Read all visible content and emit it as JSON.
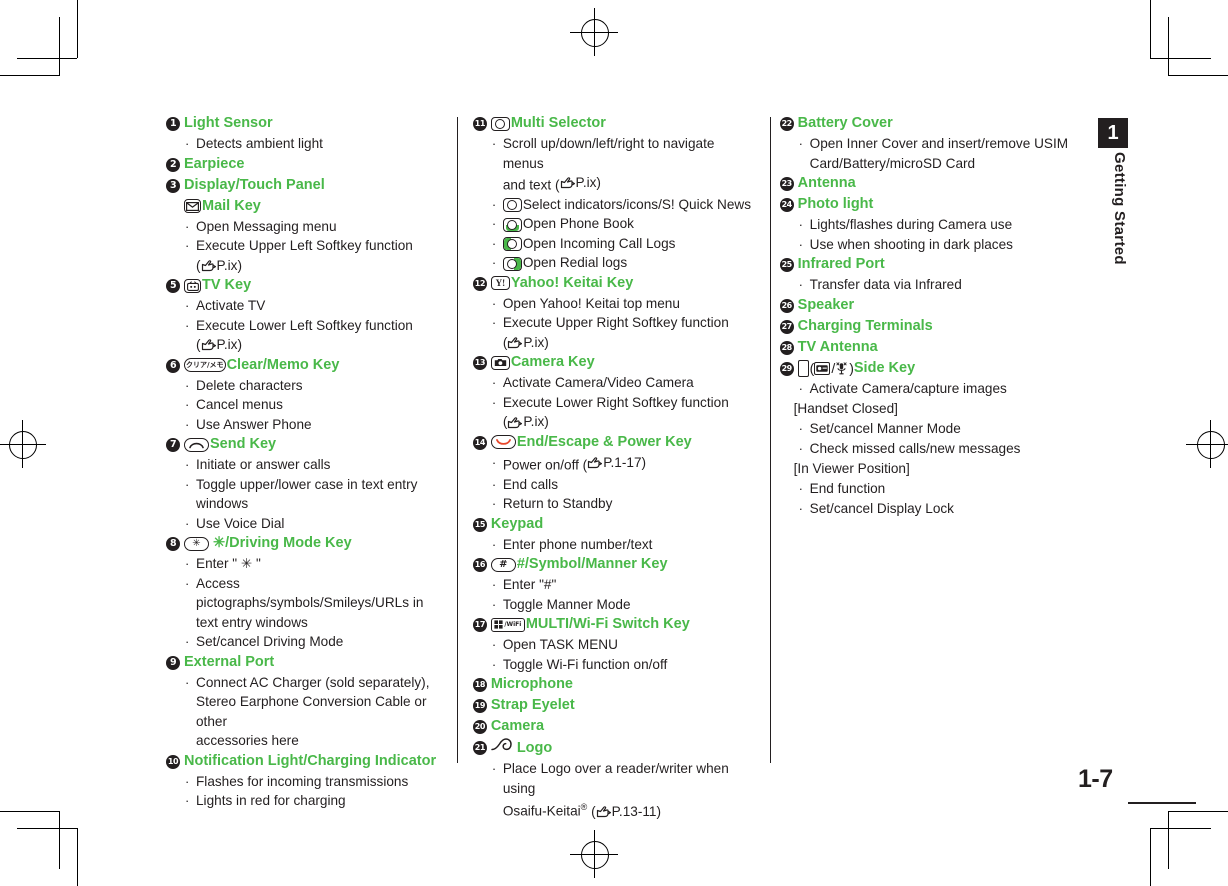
{
  "page": {
    "number": "1-7",
    "chapter_number": "1",
    "chapter_label": "Getting Started"
  },
  "columns": [
    {
      "id": "column-left",
      "items": [
        {
          "num": "❶",
          "num_text": "1",
          "title": "Light Sensor",
          "icon": null,
          "lines": [
            {
              "type": "bullet",
              "text": "Detects ambient light"
            }
          ]
        },
        {
          "num": "❷",
          "num_text": "2",
          "title": "Earpiece",
          "icon": null,
          "lines": []
        },
        {
          "num": "❸",
          "num_text": "3",
          "title": "Display/Touch Panel",
          "icon": null,
          "lines": []
        },
        {
          "num": "",
          "num_text": "",
          "title": "Mail Key",
          "icon": "mail-key-icon",
          "lines": [
            {
              "type": "bullet",
              "text": "Open Messaging menu"
            },
            {
              "type": "bullet",
              "text": "Execute Upper Left Softkey function"
            },
            {
              "type": "cont-ref",
              "text": "P.ix"
            }
          ]
        },
        {
          "num": "❺",
          "num_text": "5",
          "title": "TV Key",
          "icon": "tv-key-icon",
          "lines": [
            {
              "type": "bullet",
              "text": "Activate TV"
            },
            {
              "type": "bullet",
              "text": "Execute Lower Left Softkey function"
            },
            {
              "type": "cont-ref",
              "text": "P.ix"
            }
          ]
        },
        {
          "num": "❻",
          "num_text": "6",
          "title": "Clear/Memo Key",
          "icon": "clear-memo-key-icon",
          "icon_text": "クリア/メモ",
          "lines": [
            {
              "type": "bullet",
              "text": "Delete characters"
            },
            {
              "type": "bullet",
              "text": "Cancel menus"
            },
            {
              "type": "bullet",
              "text": "Use Answer Phone"
            }
          ]
        },
        {
          "num": "❼",
          "num_text": "7",
          "title": "Send Key",
          "icon": "send-key-icon",
          "lines": [
            {
              "type": "bullet",
              "text": "Initiate or answer calls"
            },
            {
              "type": "bullet",
              "text": "Toggle upper/lower case in text entry"
            },
            {
              "type": "cont",
              "text": "windows"
            },
            {
              "type": "bullet",
              "text": "Use Voice Dial"
            }
          ]
        },
        {
          "num": "❽",
          "num_text": "8",
          "title": "/Driving Mode Key",
          "title_prefix_glyph": "asterisk-glyph",
          "icon": "asterisk-key-icon",
          "lines": [
            {
              "type": "bullet",
              "text": "Enter \" ✳ \""
            },
            {
              "type": "bullet",
              "text": "Access pictographs/symbols/Smileys/URLs in"
            },
            {
              "type": "cont",
              "text": "text entry windows"
            },
            {
              "type": "bullet",
              "text": "Set/cancel Driving Mode"
            }
          ]
        },
        {
          "num": "❾",
          "num_text": "9",
          "title": "External Port",
          "icon": null,
          "lines": [
            {
              "type": "bullet",
              "text": "Connect AC Charger (sold separately),"
            },
            {
              "type": "cont",
              "text": "Stereo Earphone Conversion Cable or other"
            },
            {
              "type": "cont",
              "text": "accessories here"
            }
          ]
        },
        {
          "num": "❿",
          "num_text": "10",
          "title": "Notification Light/Charging Indicator",
          "icon": null,
          "lines": [
            {
              "type": "bullet",
              "text": "Flashes for incoming transmissions"
            },
            {
              "type": "bullet",
              "text": "Lights in red for charging"
            }
          ]
        }
      ]
    },
    {
      "id": "column-middle",
      "items": [
        {
          "num": "➀",
          "num_text": "11",
          "title": "Multi Selector",
          "icon": "multi-selector-icon",
          "lines": [
            {
              "type": "bullet",
              "text": "Scroll up/down/left/right to navigate menus"
            },
            {
              "type": "cont-ref2",
              "text": "and text (",
              "ref": "P.ix"
            },
            {
              "type": "bullet-icon",
              "icon": "multi-selector-center-icon",
              "text": "Select indicators/icons/S! Quick News"
            },
            {
              "type": "bullet-icon",
              "icon": "multi-selector-down-icon",
              "text": "Open Phone Book"
            },
            {
              "type": "bullet-icon",
              "icon": "multi-selector-left-icon",
              "text": "Open Incoming Call Logs"
            },
            {
              "type": "bullet-icon",
              "icon": "multi-selector-right-icon",
              "text": "Open Redial logs"
            }
          ]
        },
        {
          "num": "➁",
          "num_text": "12",
          "title": "Yahoo! Keitai Key",
          "icon": "yahoo-keitai-key-icon",
          "icon_text": "Y!",
          "lines": [
            {
              "type": "bullet",
              "text": "Open Yahoo! Keitai top menu"
            },
            {
              "type": "bullet",
              "text": "Execute Upper Right Softkey function"
            },
            {
              "type": "cont-ref",
              "text": "P.ix"
            }
          ]
        },
        {
          "num": "➂",
          "num_text": "13",
          "title": "Camera Key",
          "icon": "camera-key-icon",
          "lines": [
            {
              "type": "bullet",
              "text": "Activate Camera/Video Camera"
            },
            {
              "type": "bullet",
              "text": "Execute Lower Right Softkey function"
            },
            {
              "type": "cont-ref",
              "text": "P.ix"
            }
          ]
        },
        {
          "num": "➃",
          "num_text": "14",
          "title": "End/Escape & Power Key",
          "icon": "end-power-key-icon",
          "lines": [
            {
              "type": "bullet-ref",
              "text": "Power on/off (",
              "ref": "P.1-17"
            },
            {
              "type": "bullet",
              "text": "End calls"
            },
            {
              "type": "bullet",
              "text": "Return to Standby"
            }
          ]
        },
        {
          "num": "➄",
          "num_text": "15",
          "title": "Keypad",
          "icon": null,
          "lines": [
            {
              "type": "bullet",
              "text": "Enter phone number/text"
            }
          ]
        },
        {
          "num": "➅",
          "num_text": "16",
          "title": "#/Symbol/Manner Key",
          "icon": "hash-key-icon",
          "icon_text": "#",
          "lines": [
            {
              "type": "bullet",
              "text": "Enter \"#\""
            },
            {
              "type": "bullet",
              "text": "Toggle Manner Mode"
            }
          ]
        },
        {
          "num": "➆",
          "num_text": "17",
          "title": "MULTI/Wi-Fi Switch Key",
          "icon": "multi-wifi-key-icon",
          "icon_text": "/WiFi",
          "lines": [
            {
              "type": "bullet",
              "text": "Open TASK MENU"
            },
            {
              "type": "bullet",
              "text": "Toggle Wi-Fi function on/off"
            }
          ]
        },
        {
          "num": "➇",
          "num_text": "18",
          "title": "Microphone",
          "icon": null,
          "lines": []
        },
        {
          "num": "➈",
          "num_text": "19",
          "title": "Strap Eyelet",
          "icon": null,
          "lines": []
        },
        {
          "num": "➉",
          "num_text": "20",
          "title": "Camera",
          "icon": null,
          "lines": []
        },
        {
          "num": "➊",
          "num_text": "21",
          "title": "Logo",
          "icon": "osaifu-keitai-logo-icon",
          "lines": [
            {
              "type": "bullet",
              "text": "Place Logo over a reader/writer when using"
            },
            {
              "type": "cont-osaifu",
              "text": "Osaifu-Keitai",
              "sup": "®",
              "ref": "P.13-11"
            }
          ]
        }
      ]
    },
    {
      "id": "column-right",
      "items": [
        {
          "num": "➋",
          "num_text": "22",
          "title": "Battery Cover",
          "icon": null,
          "lines": [
            {
              "type": "bullet",
              "text": "Open Inner Cover and insert/remove USIM"
            },
            {
              "type": "cont",
              "text": "Card/Battery/microSD Card"
            }
          ]
        },
        {
          "num": "➌",
          "num_text": "23",
          "title": "Antenna",
          "icon": null,
          "lines": []
        },
        {
          "num": "➍",
          "num_text": "24",
          "title": "Photo light",
          "icon": null,
          "lines": [
            {
              "type": "bullet",
              "text": "Lights/flashes during Camera use"
            },
            {
              "type": "bullet",
              "text": "Use when shooting in dark places"
            }
          ]
        },
        {
          "num": "➎",
          "num_text": "25",
          "title": "Infrared Port",
          "icon": null,
          "lines": [
            {
              "type": "bullet",
              "text": "Transfer data via Infrared"
            }
          ]
        },
        {
          "num": "➏",
          "num_text": "26",
          "title": "Speaker",
          "icon": null,
          "lines": []
        },
        {
          "num": "➐",
          "num_text": "27",
          "title": "Charging Terminals",
          "icon": null,
          "lines": []
        },
        {
          "num": "➑",
          "num_text": "28",
          "title": "TV Antenna",
          "icon": null,
          "lines": []
        },
        {
          "num": "➒",
          "num_text": "29",
          "title": "Side Key",
          "icon": "side-key-icon",
          "lines": [
            {
              "type": "bullet",
              "text": "Activate Camera/capture images"
            },
            {
              "type": "section",
              "text": "[Handset Closed]"
            },
            {
              "type": "bullet",
              "text": "Set/cancel Manner Mode"
            },
            {
              "type": "bullet",
              "text": "Check missed calls/new messages"
            },
            {
              "type": "section",
              "text": "[In Viewer Position]"
            },
            {
              "type": "bullet",
              "text": "End function"
            },
            {
              "type": "bullet",
              "text": "Set/cancel Display Lock"
            }
          ]
        }
      ]
    }
  ],
  "colors": {
    "heading_green": "#49b849",
    "body_black": "#231f20",
    "tab_black": "#231f20",
    "end_key_red": "#e8472b"
  }
}
